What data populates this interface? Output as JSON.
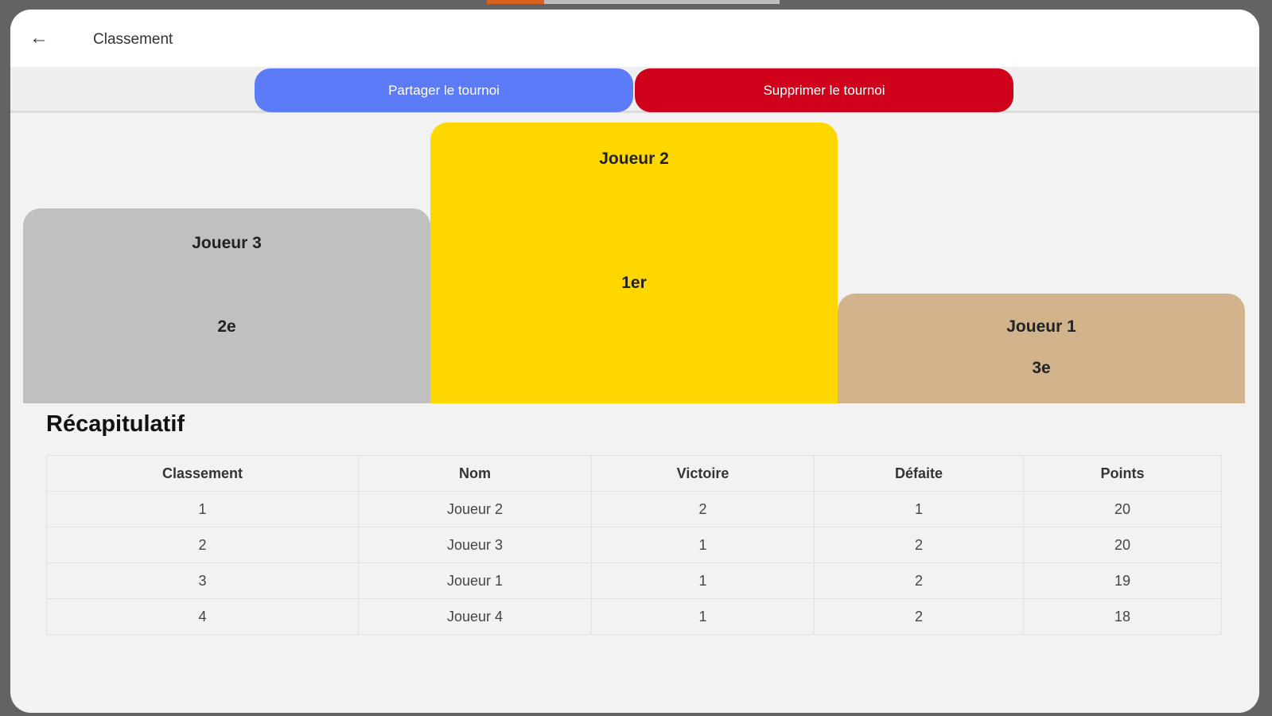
{
  "header": {
    "title": "Classement"
  },
  "actions": {
    "share": "Partager le tournoi",
    "delete": "Supprimer le tournoi"
  },
  "podium": {
    "first": {
      "name": "Joueur 2",
      "rank": "1er",
      "color": "#ffd700"
    },
    "second": {
      "name": "Joueur 3",
      "rank": "2e",
      "color": "#c0c0c0"
    },
    "third": {
      "name": "Joueur 1",
      "rank": "3e",
      "color": "#d2b48c"
    }
  },
  "summary": {
    "title": "Récapitulatif",
    "columns": [
      "Classement",
      "Nom",
      "Victoire",
      "Défaite",
      "Points"
    ],
    "rows": [
      [
        "1",
        "Joueur 2",
        "2",
        "1",
        "20"
      ],
      [
        "2",
        "Joueur 3",
        "1",
        "2",
        "20"
      ],
      [
        "3",
        "Joueur 1",
        "1",
        "2",
        "19"
      ],
      [
        "4",
        "Joueur 4",
        "1",
        "2",
        "18"
      ]
    ]
  }
}
